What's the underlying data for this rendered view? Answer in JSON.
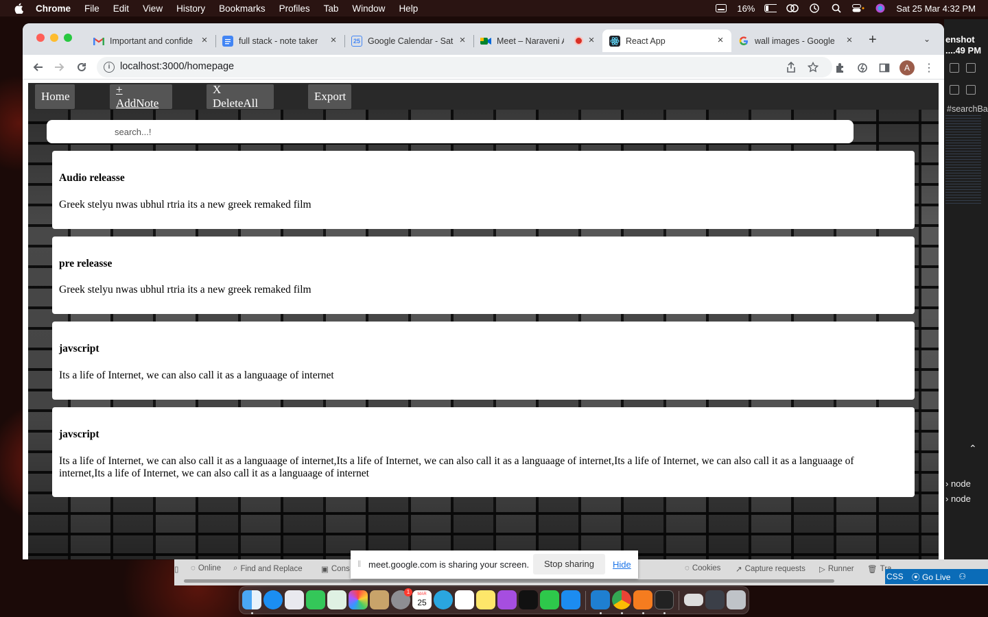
{
  "menubar": {
    "app": "Chrome",
    "items": [
      "File",
      "Edit",
      "View",
      "History",
      "Bookmarks",
      "Profiles",
      "Tab",
      "Window",
      "Help"
    ],
    "battery": "16%",
    "datetime": "Sat 25 Mar  4:32 PM"
  },
  "editor_strip": {
    "screenshot_line1": "enshot",
    "screenshot_line2": "....49 PM",
    "search_tag": "#searchBa",
    "node1": "node",
    "node2": "node"
  },
  "browser": {
    "tabs": [
      {
        "label": "Important and confide",
        "icon": "gmail-icon"
      },
      {
        "label": "full stack - note taker",
        "icon": "docs-icon"
      },
      {
        "label": "Google Calendar - Sat",
        "icon": "calendar-icon"
      },
      {
        "label": "Meet – Naraveni A",
        "icon": "meet-icon"
      },
      {
        "label": "React App",
        "icon": "react-icon"
      },
      {
        "label": "wall images - Google",
        "icon": "google-icon"
      }
    ],
    "calendar_day": "25",
    "url": "localhost:3000/homepage",
    "profile_initial": "A"
  },
  "app": {
    "nav": {
      "home": "Home",
      "add": "+ AddNote",
      "delete_all": "X DeleteAll",
      "export": "Export"
    },
    "search_placeholder": "search...!",
    "notes": [
      {
        "title": "Audio releasse",
        "body": "Greek stelyu nwas ubhul rtria its a new greek remaked film"
      },
      {
        "title": "pre releasse",
        "body": "Greek stelyu nwas ubhul rtria its a new greek remaked film"
      },
      {
        "title": "javscript",
        "body": "Its a life of Internet, we can also call it as a languaage of internet"
      },
      {
        "title": "javscript",
        "body": "Its a life of Internet, we can also call it as a languaage of internet,Its a life of Internet, we can also call it as a languaage of internet,Its a life of Internet, we can also call it as a languaage of internet,Its a life of Internet, we can also call it as a languaage of internet"
      }
    ]
  },
  "devtools": {
    "online": "Online",
    "find": "Find and Replace",
    "console": "Cons",
    "cookies": "Cookies",
    "capture": "Capture requests",
    "runner": "Runner",
    "trash": "Tra",
    "css": "CSS",
    "go_live": "Go Live"
  },
  "share_banner": {
    "message": "meet.google.com is sharing your screen.",
    "stop": "Stop sharing",
    "hide": "Hide"
  },
  "dock": {
    "calendar_month": "MAR",
    "calendar_day": "25",
    "badge": "1"
  },
  "colors": {
    "menubar": "#2a1412",
    "tabstrip": "#dee1e6",
    "navbar": "#292929",
    "nav_button": "#555555",
    "vscode_status": "#0b6cb8"
  }
}
